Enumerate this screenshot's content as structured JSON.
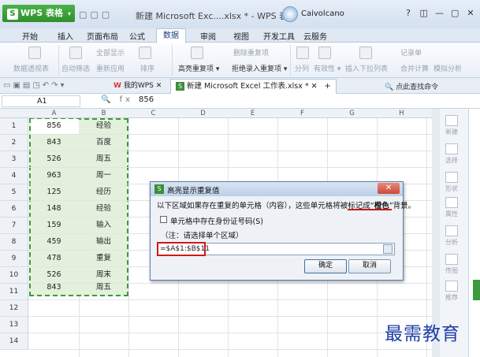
{
  "titlebar": {
    "app_name": "WPS 表格",
    "window_title": "新建 Microsoft Exc....xlsx * - WPS 表格",
    "user": "Caivolcano",
    "controls": [
      "?",
      "◫",
      "—",
      "▢",
      "✕"
    ]
  },
  "menu": [
    "开始",
    "插入",
    "页面布局",
    "公式",
    "数据",
    "审阅",
    "视图",
    "开发工具",
    "云服务"
  ],
  "menu_active": "数据",
  "ribbon": {
    "pivot": "数据透视表",
    "autofilter": "自动筛选",
    "show_all": "全部显示",
    "reapply": "重新应用",
    "sort": "排序",
    "highlight_dup": "高亮重复项 ▾",
    "delete_dup": "删除重复项",
    "reject_dup": "拒绝录入重复项 ▾",
    "split": "分列",
    "validity": "有效性 ▾",
    "insert_dropdown": "插入下拉列表",
    "record": "记录单",
    "merge_calc": "合并计算",
    "simulate": "模拟分析"
  },
  "tabs": {
    "mywps": "我的WPS",
    "file": "新建 Microsoft Excel 工作表.xlsx *",
    "search": "点此查找命令"
  },
  "formula_bar": {
    "name_box": "A1",
    "value": "856"
  },
  "columns": [
    "A",
    "B",
    "C",
    "D",
    "E",
    "F",
    "G",
    "H"
  ],
  "rows": [
    {
      "n": "1",
      "a": "856",
      "b": "经验"
    },
    {
      "n": "2",
      "a": "843",
      "b": "百度"
    },
    {
      "n": "3",
      "a": "526",
      "b": "周五"
    },
    {
      "n": "4",
      "a": "963",
      "b": "周一"
    },
    {
      "n": "5",
      "a": "125",
      "b": "经历"
    },
    {
      "n": "6",
      "a": "148",
      "b": "经验"
    },
    {
      "n": "7",
      "a": "159",
      "b": "输入"
    },
    {
      "n": "8",
      "a": "459",
      "b": "输出"
    },
    {
      "n": "9",
      "a": "478",
      "b": "重复"
    },
    {
      "n": "10",
      "a": "526",
      "b": "周末"
    },
    {
      "n": "11",
      "a": "843",
      "b": "周五"
    },
    {
      "n": "12",
      "a": "",
      "b": ""
    },
    {
      "n": "13",
      "a": "",
      "b": ""
    },
    {
      "n": "14",
      "a": "",
      "b": ""
    }
  ],
  "right_pane": [
    "新建",
    "选择",
    "形状",
    "属性",
    "分析",
    "传图",
    "推荐"
  ],
  "dialog": {
    "title": "高亮显示重复值",
    "close": "✕",
    "message_pre": "以下区域如果存在重复的单元格（内容），这些单元格将被标记成“",
    "message_hl": "橙色",
    "message_post": "”背景。",
    "checkbox_label": "单元格中存在身份证号码(S)",
    "note": "（注：请选择单个区域）",
    "range": "=$A$1:$B$11",
    "ok": "确定",
    "cancel": "取消"
  },
  "watermark": "最需教育"
}
